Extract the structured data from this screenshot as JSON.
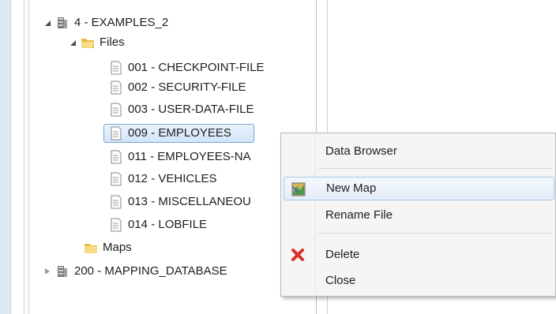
{
  "tree": {
    "nodes": [
      {
        "label": "4 - EXAMPLES_2",
        "type": "database",
        "expander": "expanded"
      },
      {
        "label": "Files",
        "type": "folder",
        "expander": "expanded"
      },
      {
        "label": "001 - CHECKPOINT-FILE",
        "type": "file"
      },
      {
        "label": "002 - SECURITY-FILE",
        "type": "file"
      },
      {
        "label": "003 - USER-DATA-FILE",
        "type": "file"
      },
      {
        "label": "009 - EMPLOYEES",
        "type": "file",
        "selected": true
      },
      {
        "label": "011 - EMPLOYEES-NA",
        "type": "file"
      },
      {
        "label": "012 - VEHICLES",
        "type": "file"
      },
      {
        "label": "013 - MISCELLANEOU",
        "type": "file"
      },
      {
        "label": "014 - LOBFILE",
        "type": "file"
      },
      {
        "label": "Maps",
        "type": "folder"
      },
      {
        "label": "200 - MAPPING_DATABASE",
        "type": "database",
        "expander": "collapsed"
      }
    ]
  },
  "context_menu": {
    "items": [
      {
        "label": "Data Browser",
        "icon": ""
      },
      {
        "label": "New Map",
        "icon": "map-icon",
        "hovered": true
      },
      {
        "label": "Rename File",
        "icon": ""
      },
      {
        "label": "Delete",
        "icon": "delete-x-icon"
      },
      {
        "label": "Close",
        "icon": ""
      }
    ]
  },
  "colors": {
    "selection_border": "#7da2ce",
    "selection_fill": "#d2e5fa",
    "delete_icon": "#d9302a",
    "folder": "#f2cf6b"
  }
}
